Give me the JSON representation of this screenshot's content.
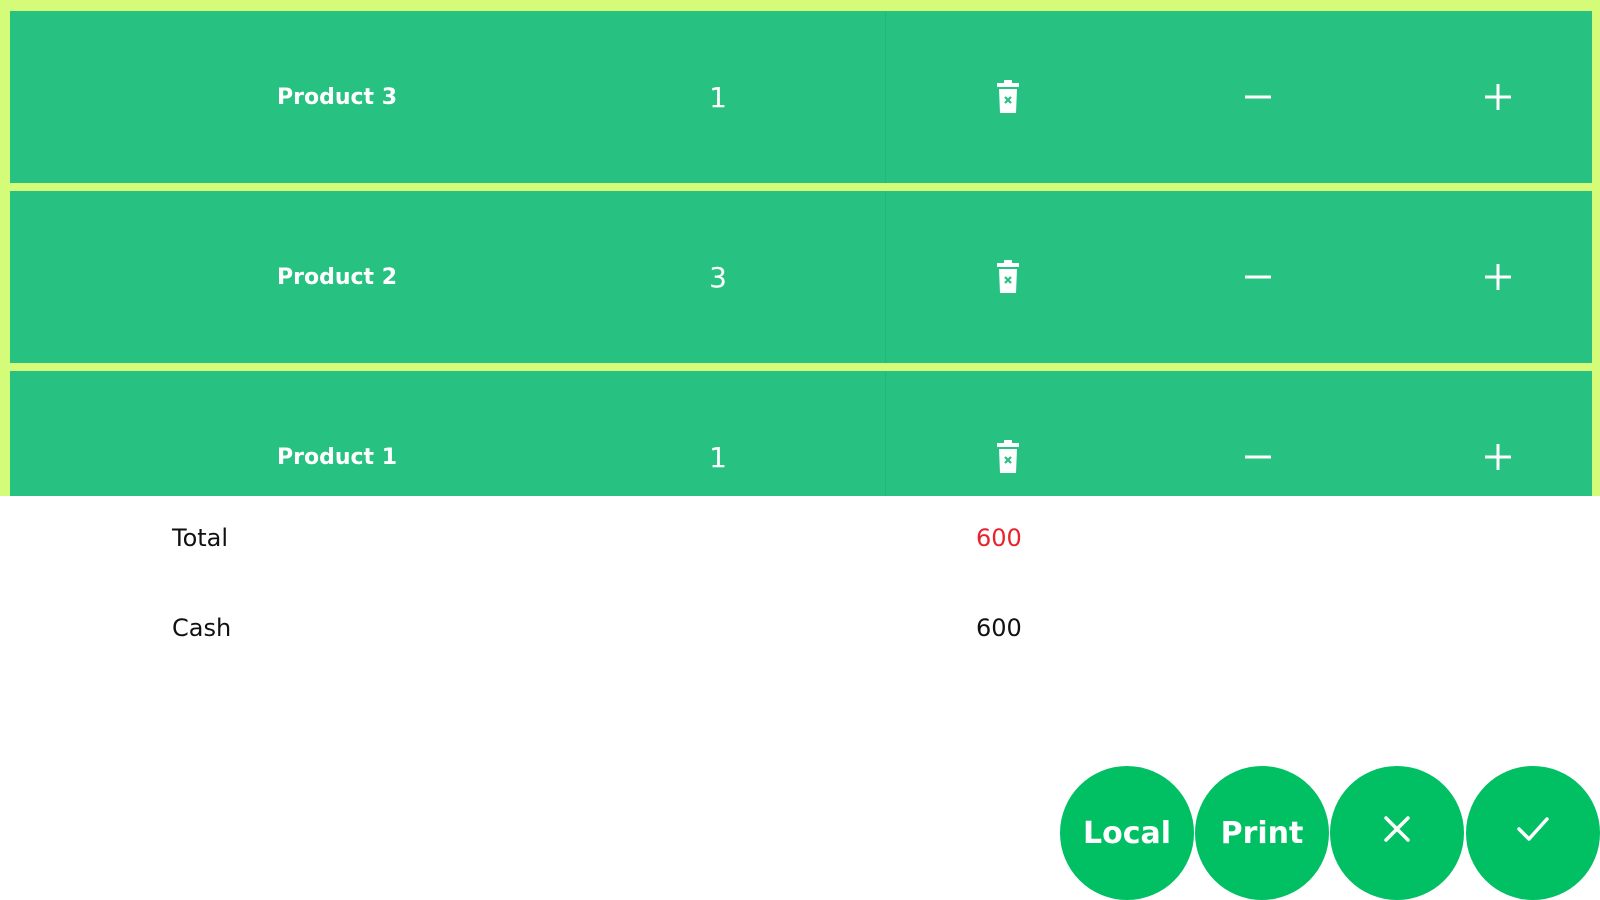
{
  "order": {
    "items": [
      {
        "name": "Product 3",
        "quantity": "1"
      },
      {
        "name": "Product 2",
        "quantity": "3"
      },
      {
        "name": "Product 1",
        "quantity": "1"
      }
    ]
  },
  "summary": {
    "total_label": "Total",
    "total_value": "600",
    "cash_label": "Cash",
    "cash_value": "600"
  },
  "actions": {
    "local_label": "Local",
    "print_label": "Print",
    "cancel_icon": "close-icon",
    "confirm_icon": "check-icon"
  },
  "colors": {
    "row_background": "#27c281",
    "row_border": "#d4fc79",
    "button_background": "#00c063",
    "total_value": "#e8232d"
  }
}
